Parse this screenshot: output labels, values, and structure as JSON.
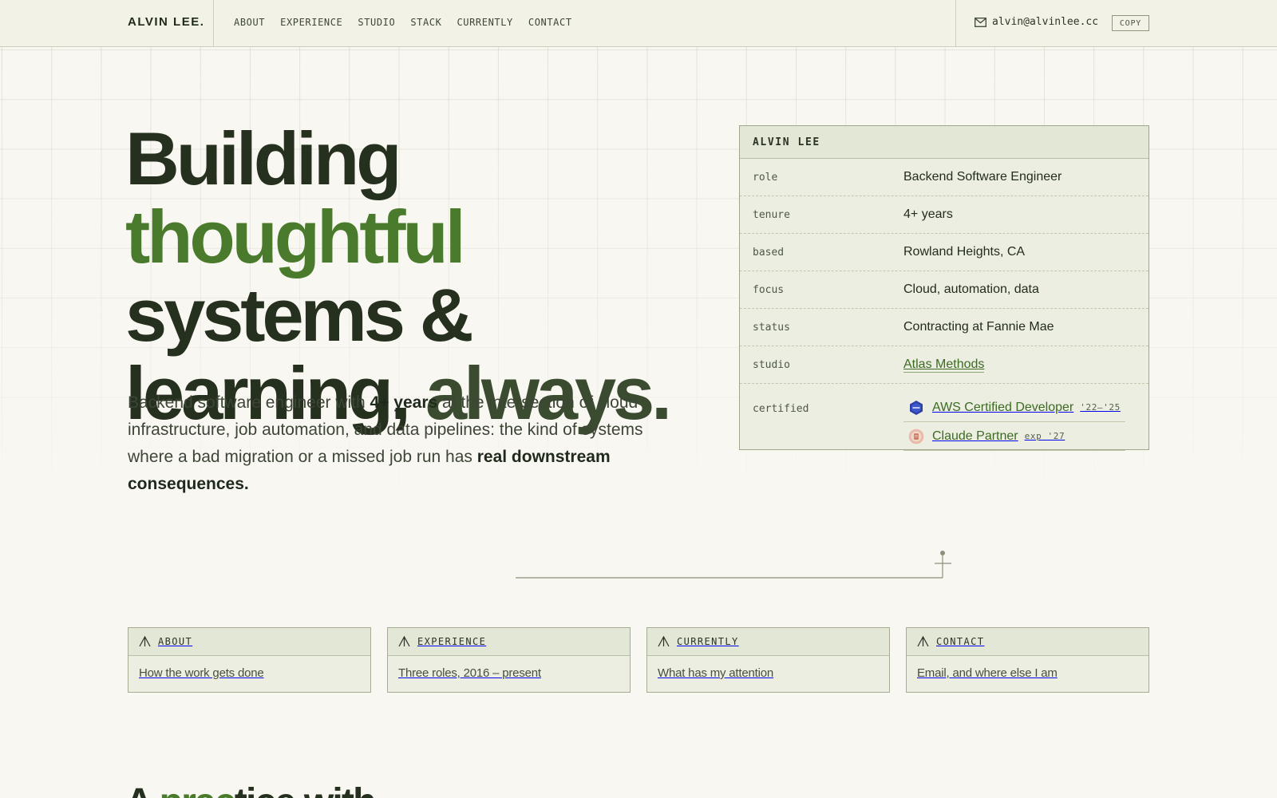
{
  "nav": {
    "brand": "ALVIN LEE.",
    "links": [
      "ABOUT",
      "EXPERIENCE",
      "STUDIO",
      "STACK",
      "CURRENTLY",
      "CONTACT"
    ],
    "email": "alvin@alvinlee.cc",
    "copy_label": "COPY",
    "email_icon": "mail-icon"
  },
  "hero": {
    "headline": {
      "line1_a": "Building ",
      "line1_b": "thoughtful",
      "line2": "systems &",
      "line3_a": "learning, ",
      "line3_b": "always."
    },
    "intro": {
      "p1": "Backend software engineer with ",
      "b1": "4+ years",
      "p2": " at the intersection of cloud infrastructure, job automation, and data pipelines: the kind of systems where a bad migration or a missed job run has ",
      "b2": "real downstream consequences."
    }
  },
  "profile": {
    "title": "ALVIN LEE",
    "rows": [
      {
        "key": "role",
        "value": "Backend Software Engineer"
      },
      {
        "key": "tenure",
        "value": "4+ years"
      },
      {
        "key": "based",
        "value": "Rowland Heights, CA"
      },
      {
        "key": "focus",
        "value": "Cloud, automation, data"
      },
      {
        "key": "status",
        "value": "Contracting at Fannie Mae"
      },
      {
        "key": "studio",
        "value": "Atlas Methods"
      }
    ],
    "certified_key": "certified",
    "certs": [
      {
        "name": "AWS Certified Developer",
        "years": "'22–'25",
        "icon": "aws-badge-icon"
      },
      {
        "name": "Claude Partner",
        "years": "exp '27",
        "icon": "claude-badge-icon"
      }
    ]
  },
  "tiles": [
    {
      "label": "ABOUT",
      "desc": "How the work gets done"
    },
    {
      "label": "EXPERIENCE",
      "desc": "Three roles, 2016 – present"
    },
    {
      "label": "CURRENTLY",
      "desc": "What has my attention"
    },
    {
      "label": "CONTACT",
      "desc": "Email, and where else I am"
    }
  ],
  "next_section": {
    "a": "A ",
    "b": "prac",
    "c": "tice with"
  },
  "colors": {
    "background": "#f9f7f1",
    "accent_green": "#4a7a2c",
    "ink": "#26301f",
    "card_bg": "#ebeee0"
  }
}
